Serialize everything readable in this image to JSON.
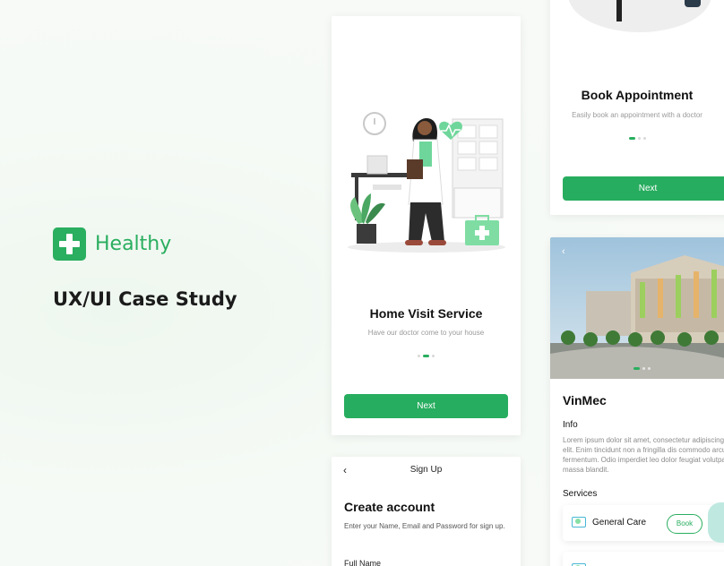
{
  "brand": {
    "name": "Healthy",
    "subtitle": "UX/UI Case Study"
  },
  "onboarding_home_visit": {
    "title": "Home Visit Service",
    "subtitle": "Have our doctor come to your house",
    "dots": [
      false,
      true,
      false
    ],
    "next_label": "Next"
  },
  "onboarding_book": {
    "title": "Book Appointment",
    "subtitle": "Easily book an appointment with a doctor",
    "dots": [
      true,
      false,
      false
    ],
    "next_label": "Next"
  },
  "signup": {
    "back_glyph": "‹",
    "header_title": "Sign Up",
    "title": "Create account",
    "subtitle": "Enter your Name, Email and Password for sign up.",
    "field_label": "Full Name"
  },
  "hospital": {
    "back_glyph": "‹",
    "name": "VinMec",
    "info_label": "Info",
    "info_text": "Lorem ipsum dolor sit amet, consectetur adipiscing elit. Enim tincidunt non a fringilla dis commodo arcu fermentum. Odio imperdiet leo dolor feugiat volutpat massa blandit.",
    "services_label": "Services",
    "services": [
      {
        "name": "General Care",
        "book_label": "Book"
      },
      {
        "name": "",
        "book_label": ""
      }
    ],
    "image_dots": [
      true,
      false,
      false
    ]
  },
  "colors": {
    "accent": "#2aae5f",
    "button": "#27ad5f"
  }
}
